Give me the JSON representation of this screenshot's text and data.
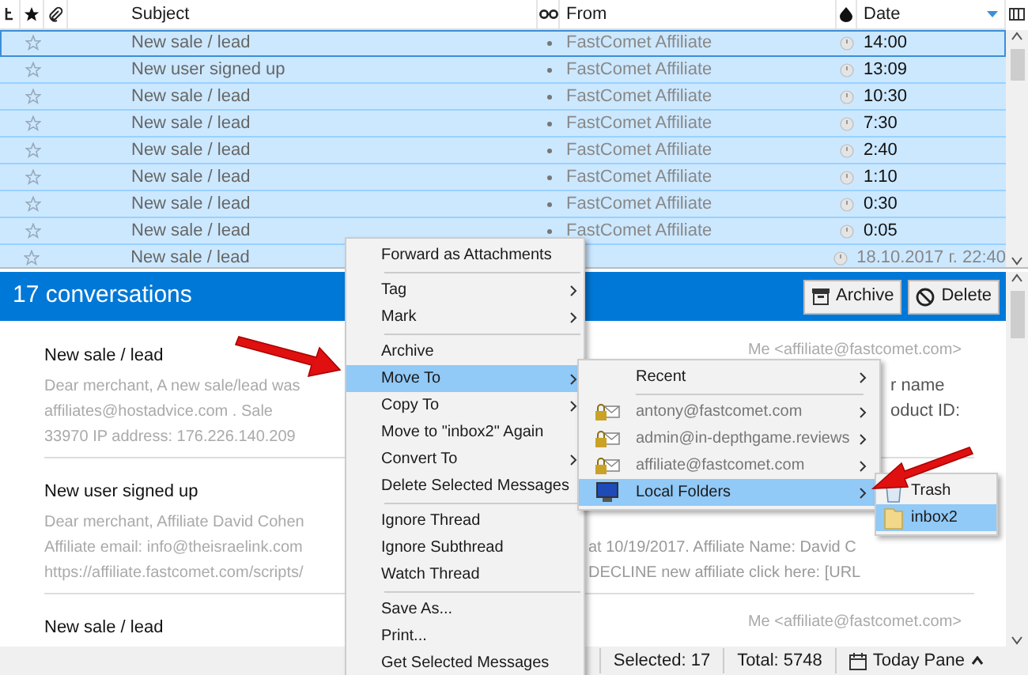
{
  "thread_pane": {
    "columns": [
      {
        "kind": "icon"
      },
      {
        "kind": "icon"
      },
      {
        "kind": "icon"
      },
      {
        "kind": "text",
        "label": "Subject"
      },
      {
        "kind": "icon"
      },
      {
        "kind": "text",
        "label": "From"
      },
      {
        "kind": "icon"
      },
      {
        "kind": "text",
        "label": "Date",
        "sorted": true
      }
    ],
    "rows": [
      {
        "subject": "New sale / lead",
        "from": "FastComet Affiliate",
        "date": "14:00",
        "selected": true,
        "focused": true
      },
      {
        "subject": "New user signed up",
        "from": "FastComet Affiliate",
        "date": "13:09",
        "selected": true,
        "focused": false
      },
      {
        "subject": "New sale / lead",
        "from": "FastComet Affiliate",
        "date": "10:30",
        "selected": true,
        "focused": false
      },
      {
        "subject": "New sale / lead",
        "from": "FastComet Affiliate",
        "date": "7:30",
        "selected": true,
        "focused": false
      },
      {
        "subject": "New sale / lead",
        "from": "FastComet Affiliate",
        "date": "2:40",
        "selected": true,
        "focused": false
      },
      {
        "subject": "New sale / lead",
        "from": "FastComet Affiliate",
        "date": "1:10",
        "selected": true,
        "focused": false
      },
      {
        "subject": "New sale / lead",
        "from": "FastComet Affiliate",
        "date": "0:30",
        "selected": true,
        "focused": false
      },
      {
        "subject": "New sale / lead",
        "from": "FastComet Affiliate",
        "date": "0:05",
        "selected": true,
        "focused": false
      },
      {
        "subject": "New sale / lead",
        "date": "18.10.2017 г. 22:40",
        "selected": true,
        "focused": false
      }
    ]
  },
  "summary": {
    "title": "17 conversations",
    "buttons": [
      "Archive",
      "Delete"
    ],
    "conversations": [
      {
        "subject": "New sale / lead",
        "sender": "Me <affiliate@fastcomet.com>",
        "lines": [
          {
            "left": "Dear merchant, A new sale/lead was",
            "right": "r name"
          },
          {
            "left": "affiliates@hostadvice.com . Sale",
            "right": "oduct ID:"
          },
          {
            "left": "33970 IP address: 176.226.140.209"
          }
        ]
      },
      {
        "subject": "New user signed up",
        "lines": [
          {
            "left": "Dear merchant, Affiliate David Cohen"
          },
          {
            "left": "Affiliate email: info@theisraelink.com",
            "right": "at 10/19/2017. Affiliate Name: David C"
          },
          {
            "left": "https://affiliate.fastcomet.com/scripts/",
            "right": "DECLINE new affiliate click here: [URL"
          }
        ]
      },
      {
        "subject": "New sale / lead",
        "sender": "Me <affiliate@fastcomet.com>"
      }
    ]
  },
  "status_bar": {
    "selected": "Selected: 17",
    "total": "Total: 5748",
    "today_pane": "Today Pane"
  },
  "context_menu": [
    {
      "kind": "item",
      "label": "Forward as Attachments",
      "submenu": false,
      "selected": false
    },
    {
      "kind": "separator"
    },
    {
      "kind": "item",
      "label": "Tag",
      "submenu": true,
      "selected": false
    },
    {
      "kind": "item",
      "label": "Mark",
      "submenu": true,
      "selected": false
    },
    {
      "kind": "separator"
    },
    {
      "kind": "item",
      "label": "Archive",
      "submenu": false,
      "selected": false
    },
    {
      "kind": "item",
      "label": "Move To",
      "submenu": true,
      "selected": true
    },
    {
      "kind": "item",
      "label": "Copy To",
      "submenu": true,
      "selected": false
    },
    {
      "kind": "item",
      "label": "Move to \"inbox2\" Again",
      "submenu": false,
      "selected": false
    },
    {
      "kind": "item",
      "label": "Convert To",
      "submenu": true,
      "selected": false
    },
    {
      "kind": "item",
      "label": "Delete Selected Messages",
      "submenu": false,
      "selected": false
    },
    {
      "kind": "separator"
    },
    {
      "kind": "item",
      "label": "Ignore Thread",
      "submenu": false,
      "selected": false
    },
    {
      "kind": "item",
      "label": "Ignore Subthread",
      "submenu": false,
      "selected": false
    },
    {
      "kind": "item",
      "label": "Watch Thread",
      "submenu": false,
      "selected": false
    },
    {
      "kind": "separator"
    },
    {
      "kind": "item",
      "label": "Save As...",
      "submenu": false,
      "selected": false
    },
    {
      "kind": "item",
      "label": "Print...",
      "submenu": false,
      "selected": false
    },
    {
      "kind": "item",
      "label": "Get Selected Messages",
      "submenu": false,
      "selected": false
    }
  ],
  "move_to_menu": [
    {
      "kind": "item",
      "label": "Recent",
      "submenu": true,
      "selected": false
    },
    {
      "kind": "separator"
    },
    {
      "kind": "account",
      "label": "antony@fastcomet.com",
      "submenu": true,
      "selected": false
    },
    {
      "kind": "account",
      "label": "admin@in-depthgame.reviews",
      "submenu": true,
      "selected": false
    },
    {
      "kind": "account",
      "label": "affiliate@fastcomet.com",
      "submenu": true,
      "selected": false
    },
    {
      "kind": "computer",
      "label": "Local Folders",
      "submenu": true,
      "selected": true
    }
  ],
  "local_folders_menu": [
    {
      "kind": "trash",
      "label": "Trash",
      "selected": false
    },
    {
      "kind": "folder",
      "label": "inbox2",
      "selected": true
    }
  ]
}
